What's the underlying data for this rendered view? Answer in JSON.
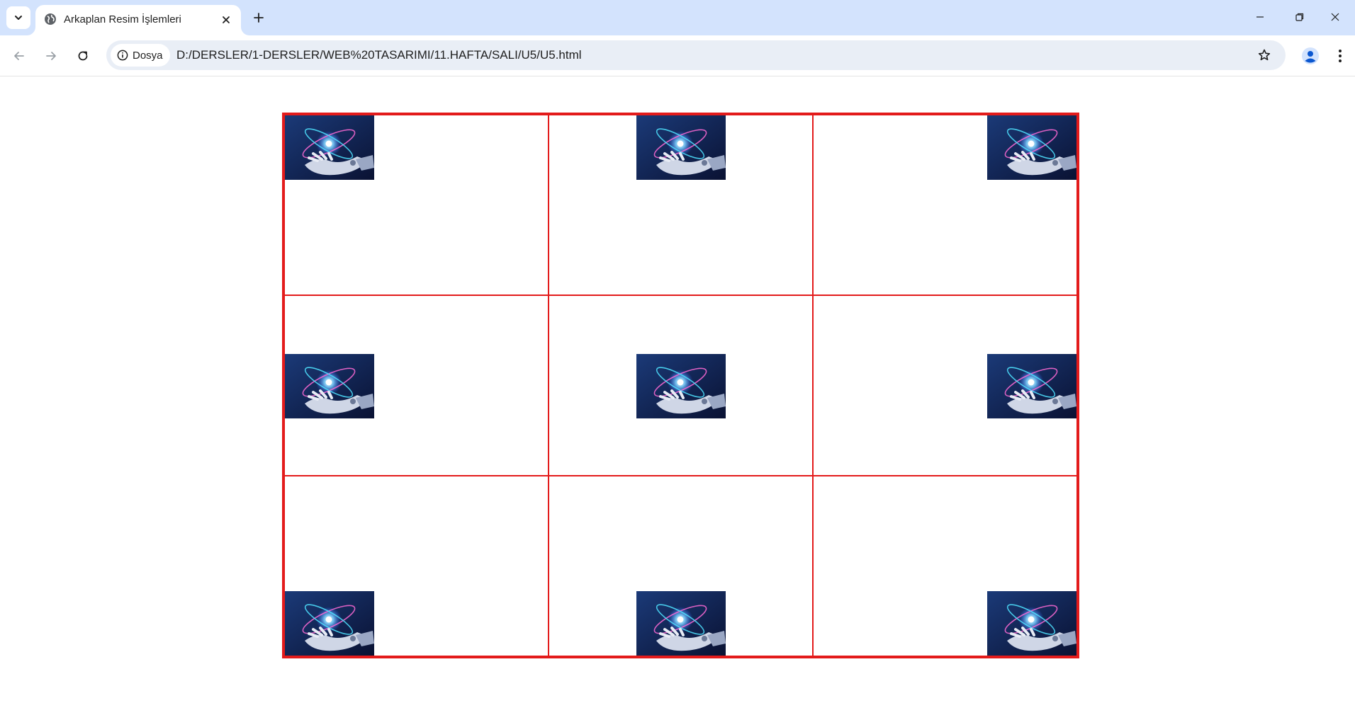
{
  "browser": {
    "tab": {
      "title": "Arkaplan Resim İşlemleri"
    },
    "address": {
      "site_chip_label": "Dosya",
      "url": "D:/DERSLER/1-DERSLER/WEB%20TASARIMI/11.HAFTA/SALI/U5/U5.html"
    },
    "colors": {
      "tabstrip": "#d3e3fd",
      "omnibox": "#e9eef6",
      "profile": "#0b57d0"
    }
  },
  "page": {
    "border_color": "#e31b1b",
    "cells": [
      {
        "name": "cell-top-left",
        "position": "left top"
      },
      {
        "name": "cell-top-center",
        "position": "center top"
      },
      {
        "name": "cell-top-right",
        "position": "right top"
      },
      {
        "name": "cell-middle-left",
        "position": "left center"
      },
      {
        "name": "cell-middle-center",
        "position": "center center"
      },
      {
        "name": "cell-middle-right",
        "position": "right center"
      },
      {
        "name": "cell-bottom-left",
        "position": "left bottom"
      },
      {
        "name": "cell-bottom-center",
        "position": "center bottom"
      },
      {
        "name": "cell-bottom-right",
        "position": "right bottom"
      }
    ],
    "image": {
      "icon": "robot-hand-atom-image"
    }
  }
}
